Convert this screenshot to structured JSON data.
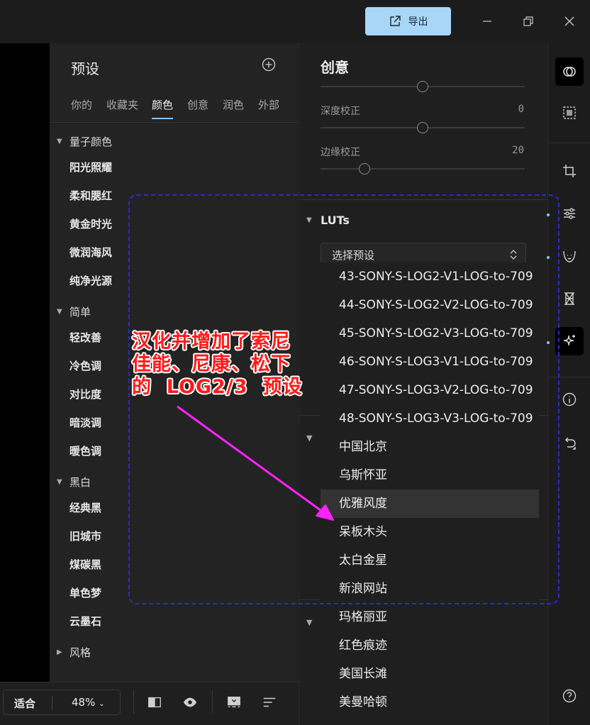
{
  "titlebar": {
    "export_label": "导出"
  },
  "presets": {
    "title": "预设",
    "tabs": [
      "你的",
      "收藏夹",
      "颜色",
      "创意",
      "润色",
      "外部"
    ],
    "active_tab": "颜色",
    "groups": [
      {
        "name": "量子颜色",
        "expanded": true,
        "items": [
          "阳光照耀",
          "柔和腮红",
          "黄金时光",
          "微润海风",
          "纯净光源"
        ]
      },
      {
        "name": "简单",
        "expanded": true,
        "items": [
          "轻改善",
          "冷色调",
          "对比度",
          "暗淡调",
          "暖色调"
        ]
      },
      {
        "name": "黑白",
        "expanded": true,
        "items": [
          "经典黑",
          "旧城市",
          "煤碳黑",
          "单色梦",
          "云墨石"
        ]
      },
      {
        "name": "风格",
        "expanded": false,
        "items": []
      }
    ]
  },
  "creative": {
    "title": "创意",
    "sliders": [
      {
        "label": "深度校正",
        "value": "0"
      },
      {
        "label": "边缘校正",
        "value": "20"
      }
    ],
    "luts": {
      "title": "LUTs",
      "select_placeholder": "选择预设"
    }
  },
  "dropdown": {
    "items": [
      "43-SONY-S-LOG2-V1-LOG-to-709",
      "44-SONY-S-LOG2-V2-LOG-to-709",
      "45-SONY-S-LOG2-V3-LOG-to-709",
      "46-SONY-S-LOG3-V1-LOG-to-709",
      "47-SONY-S-LOG3-V2-LOG-to-709",
      "48-SONY-S-LOG3-V3-LOG-to-709",
      "中国北京",
      "乌斯怀亚",
      "优雅风度",
      "呆板木头",
      "太白金星",
      "新浪网站",
      "玛格丽亚",
      "红色痕迹",
      "美国长滩",
      "美曼哈顿"
    ],
    "hover_item": "优雅风度"
  },
  "bottombar": {
    "fit_label": "适合",
    "zoom_label": "48%"
  },
  "annotation": {
    "lines": [
      "汉化并增加了索尼",
      "佳能、尼康、松下",
      "的  LOG2/3  预设"
    ],
    "color": "#ff1a1a",
    "box_color": "#2a2ad8"
  },
  "colors": {
    "accent": "#8bc3ee",
    "export_button": "#a8d6f6"
  }
}
